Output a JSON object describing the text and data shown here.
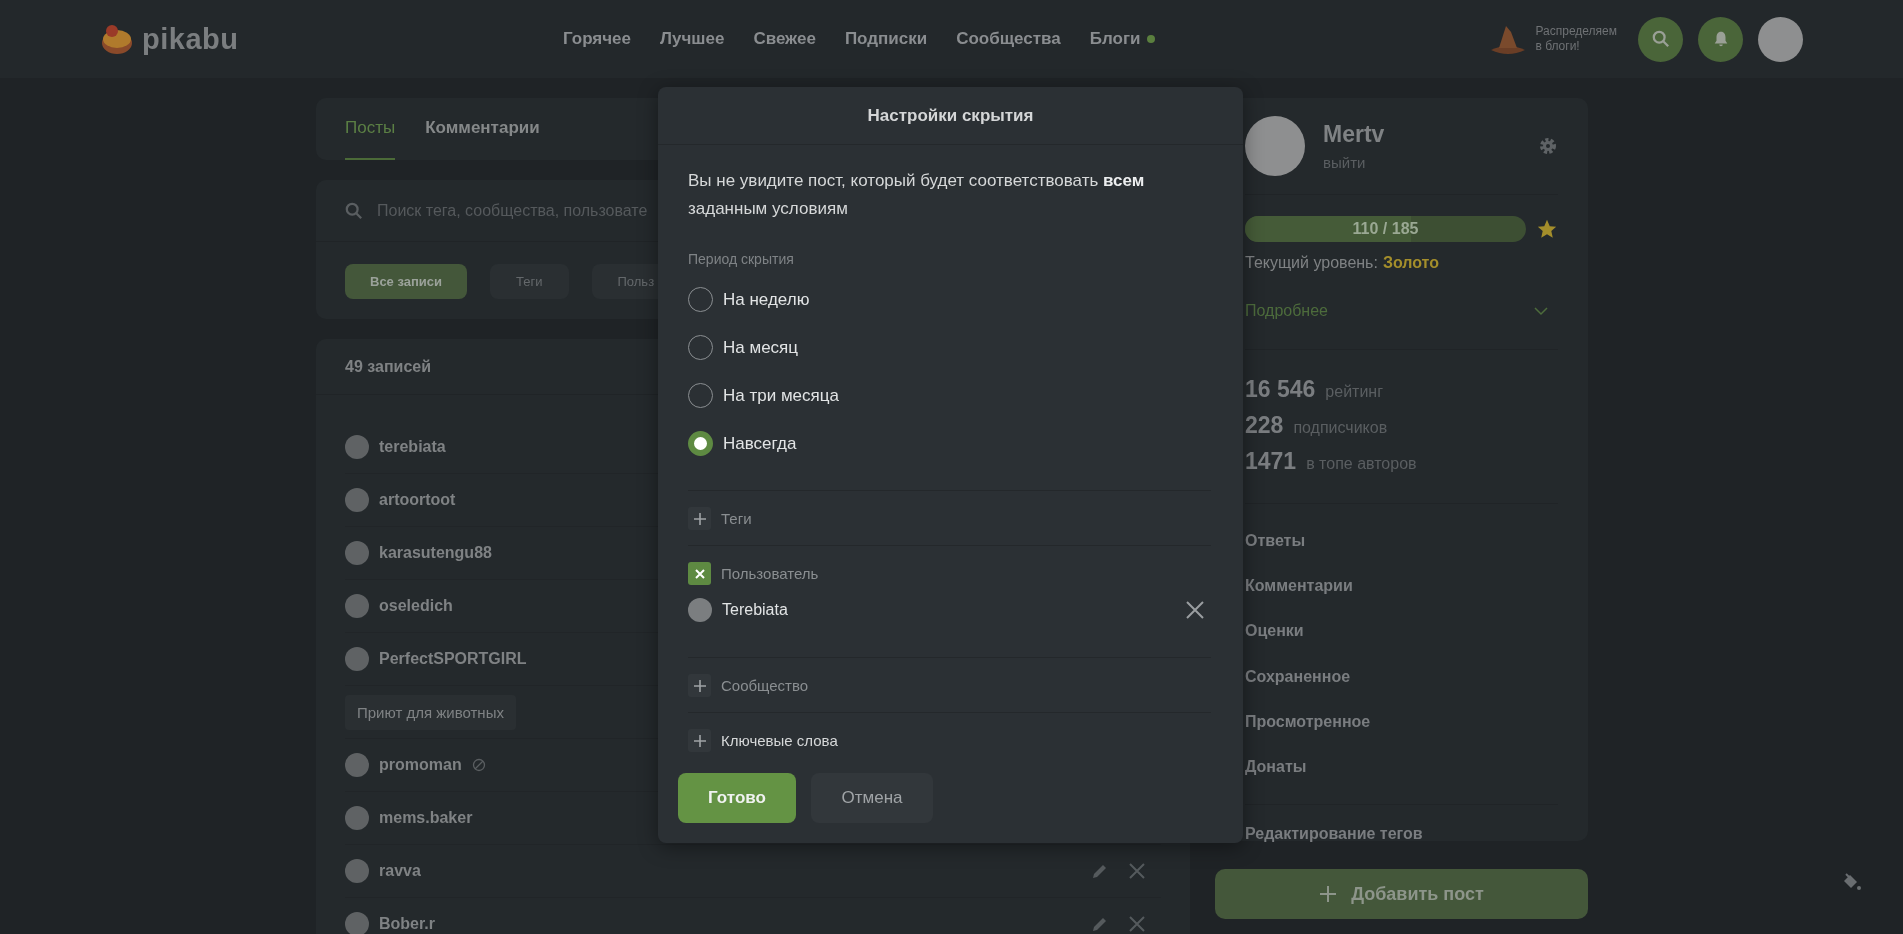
{
  "header": {
    "logo_text": "pikabu",
    "nav": [
      {
        "label": "Горячее",
        "dot": false
      },
      {
        "label": "Лучшее",
        "dot": false
      },
      {
        "label": "Свежее",
        "dot": false
      },
      {
        "label": "Подписки",
        "dot": false
      },
      {
        "label": "Сообщества",
        "dot": false
      },
      {
        "label": "Блоги",
        "dot": true
      }
    ],
    "promo_lines": [
      "Распределяем",
      "в блоги!"
    ]
  },
  "left": {
    "tabs": [
      {
        "label": "Посты",
        "selected": true
      },
      {
        "label": "Комментарии",
        "selected": false
      }
    ],
    "search": {
      "placeholder": "Поиск тега, сообщества, пользовате"
    },
    "filters": [
      {
        "label": "Все записи",
        "selected": true
      },
      {
        "label": "Теги",
        "selected": false
      },
      {
        "label": "Польз",
        "selected": false
      }
    ],
    "count": "49 записей",
    "rows": [
      {
        "kind": "user",
        "name": "terebiata"
      },
      {
        "kind": "user",
        "name": "artoortoot"
      },
      {
        "kind": "user",
        "name": "karasutengu88"
      },
      {
        "kind": "user",
        "name": "oseledich"
      },
      {
        "kind": "user",
        "name": "PerfectSPORTGIRL"
      },
      {
        "kind": "community",
        "name": "Приют для животных"
      },
      {
        "kind": "user",
        "name": "promoman",
        "blocked": true
      },
      {
        "kind": "user",
        "name": "mems.baker"
      },
      {
        "kind": "user",
        "name": "ravva",
        "actions": true
      },
      {
        "kind": "user",
        "name": "Bober.r",
        "actions": true
      }
    ]
  },
  "right": {
    "name": "Mertv",
    "logout": "выйти",
    "progress": {
      "text": "110 / 185",
      "level": 0.59
    },
    "level_label": "Текущий уровень:",
    "level_value": "Золото",
    "more": "Подробнее",
    "stats": [
      {
        "value": "16 546",
        "label": "рейтинг"
      },
      {
        "value": "228",
        "label": "подписчиков"
      },
      {
        "value": "1471",
        "label": "в топе авторов"
      }
    ],
    "menu": [
      "Ответы",
      "Комментарии",
      "Оценки",
      "Сохраненное",
      "Просмотренное",
      "Донаты"
    ],
    "edit_tags": "Редактирование тегов",
    "add_post": "Добавить пост"
  },
  "modal": {
    "title": "Настройки скрытия",
    "description": "Вы не увидите пост, который будет соответствовать **всем** заданным условиям",
    "period_label": "Период скрытия",
    "options": [
      {
        "label": "На неделю",
        "selected": false
      },
      {
        "label": "На месяц",
        "selected": false
      },
      {
        "label": "На три месяца",
        "selected": false
      },
      {
        "label": "Навсегда",
        "selected": true
      }
    ],
    "sections": [
      {
        "label": "Теги",
        "checked": false,
        "muted": true
      },
      {
        "label": "Пользователь",
        "checked": true,
        "muted": true,
        "items": [
          {
            "name": "Terebiata"
          }
        ]
      },
      {
        "label": "Сообщество",
        "checked": false,
        "muted": true
      },
      {
        "label": "Ключевые слова",
        "checked": false,
        "muted": false
      }
    ],
    "confirm": "Готово",
    "cancel": "Отмена"
  }
}
